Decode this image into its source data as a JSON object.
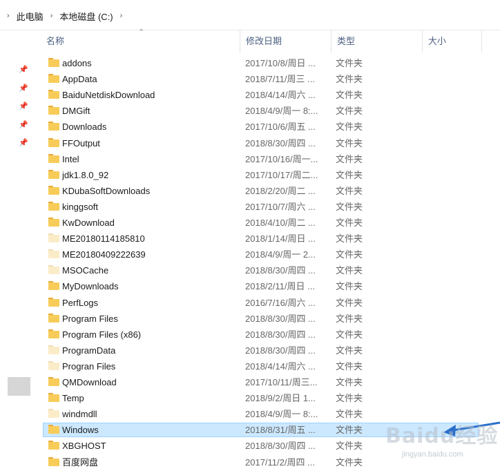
{
  "breadcrumb": {
    "items": [
      "此电脑",
      "本地磁盘 (C:)"
    ]
  },
  "columns": {
    "name": "名称",
    "date": "修改日期",
    "type": "类型",
    "size": "大小"
  },
  "rows": [
    {
      "name": "addons",
      "date": "2017/10/8/周日 ...",
      "type": "文件夹"
    },
    {
      "name": "AppData",
      "date": "2018/7/11/周三 ...",
      "type": "文件夹"
    },
    {
      "name": "BaiduNetdiskDownload",
      "date": "2018/4/14/周六 ...",
      "type": "文件夹"
    },
    {
      "name": "DMGift",
      "date": "2018/4/9/周一 8:...",
      "type": "文件夹"
    },
    {
      "name": "Downloads",
      "date": "2017/10/6/周五 ...",
      "type": "文件夹"
    },
    {
      "name": "FFOutput",
      "date": "2018/8/30/周四 ...",
      "type": "文件夹"
    },
    {
      "name": "Intel",
      "date": "2017/10/16/周一...",
      "type": "文件夹"
    },
    {
      "name": "jdk1.8.0_92",
      "date": "2017/10/17/周二...",
      "type": "文件夹"
    },
    {
      "name": "KDubaSoftDownloads",
      "date": "2018/2/20/周二 ...",
      "type": "文件夹"
    },
    {
      "name": "kinggsoft",
      "date": "2017/10/7/周六 ...",
      "type": "文件夹"
    },
    {
      "name": "KwDownload",
      "date": "2018/4/10/周二 ...",
      "type": "文件夹"
    },
    {
      "name": "ME20180114185810",
      "date": "2018/1/14/周日 ...",
      "type": "文件夹"
    },
    {
      "name": "ME20180409222639",
      "date": "2018/4/9/周一 2...",
      "type": "文件夹"
    },
    {
      "name": "MSOCache",
      "date": "2018/8/30/周四 ...",
      "type": "文件夹"
    },
    {
      "name": "MyDownloads",
      "date": "2018/2/11/周日 ...",
      "type": "文件夹"
    },
    {
      "name": "PerfLogs",
      "date": "2016/7/16/周六 ...",
      "type": "文件夹"
    },
    {
      "name": "Program Files",
      "date": "2018/8/30/周四 ...",
      "type": "文件夹"
    },
    {
      "name": "Program Files (x86)",
      "date": "2018/8/30/周四 ...",
      "type": "文件夹"
    },
    {
      "name": "ProgramData",
      "date": "2018/8/30/周四 ...",
      "type": "文件夹"
    },
    {
      "name": "Progran Files",
      "date": "2018/4/14/周六 ...",
      "type": "文件夹"
    },
    {
      "name": "QMDownload",
      "date": "2017/10/11/周三...",
      "type": "文件夹"
    },
    {
      "name": "Temp",
      "date": "2018/9/2/周日 1...",
      "type": "文件夹"
    },
    {
      "name": "windmdll",
      "date": "2018/4/9/周一 8:...",
      "type": "文件夹"
    },
    {
      "name": "Windows",
      "date": "2018/8/31/周五 ...",
      "type": "文件夹"
    },
    {
      "name": "XBGHOST",
      "date": "2018/8/30/周四 ...",
      "type": "文件夹"
    },
    {
      "name": "百度网盘",
      "date": "2017/11/2/周四 ...",
      "type": "文件夹"
    }
  ],
  "selected_row": "Windows",
  "faded_rows": [
    "ME20180114185810",
    "ME20180409222639",
    "MSOCache",
    "ProgramData",
    "Progran Files",
    "windmdll"
  ],
  "watermark": {
    "text": "Baidu经验",
    "sub": "jingyan.baidu.com"
  },
  "colors": {
    "selection_bg": "#cce8ff",
    "selection_border": "#99d1ff",
    "folder": "#f8cc58",
    "header_text": "#4d6082",
    "arrow": "#2a6fc9"
  }
}
